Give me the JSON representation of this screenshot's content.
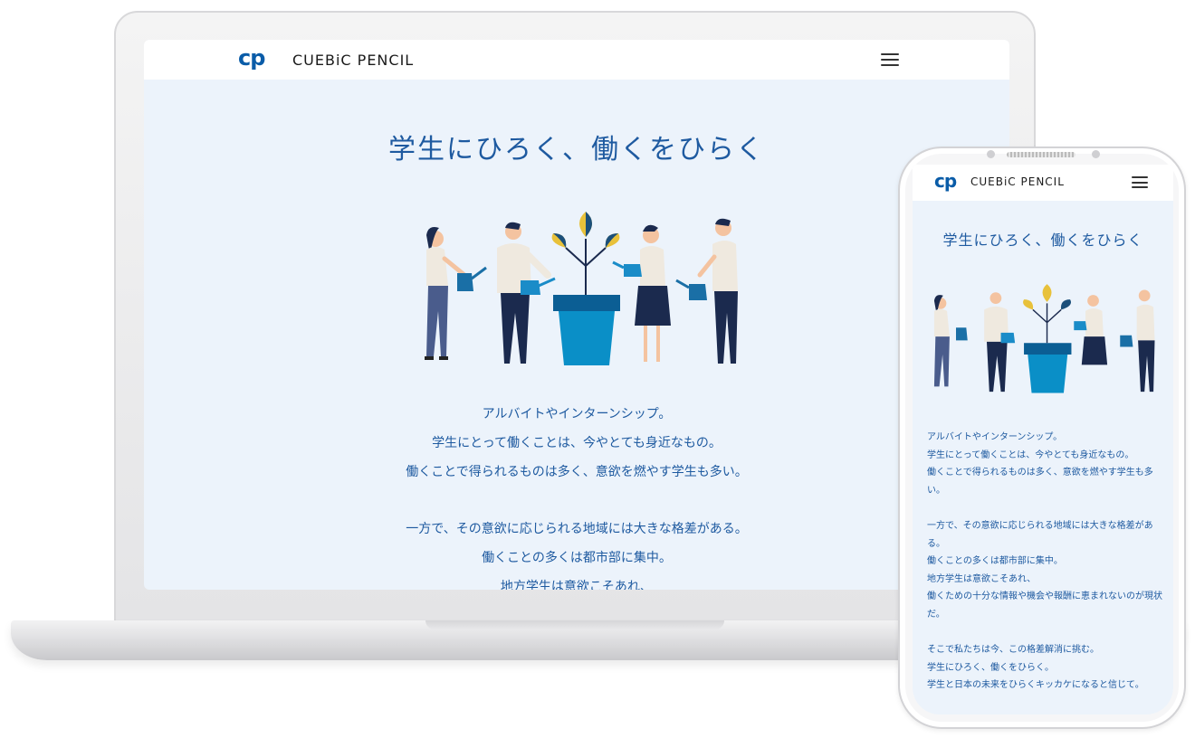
{
  "brand": {
    "mark": "cp",
    "name": "CUEBiC PENCIL"
  },
  "hero": {
    "title": "学生にひろく、働くをひらく"
  },
  "desktop_copy": [
    "アルバイトやインターンシップ。",
    "学生にとって働くことは、今やとても身近なもの。",
    "働くことで得られるものは多く、意欲を燃やす学生も多い。",
    "",
    "一方で、その意欲に応じられる地域には大きな格差がある。",
    "働くことの多くは都市部に集中。",
    "地方学生は意欲こそあれ、"
  ],
  "mobile_copy": [
    "アルバイトやインターンシップ。",
    "学生にとって働くことは、今やとても身近なもの。",
    "働くことで得られるものは多く、意欲を燃やす学生も多",
    "い。",
    "",
    "一方で、その意欲に応じられる地域には大きな格差があ",
    "る。",
    "働くことの多くは都市部に集中。",
    "地方学生は意欲こそあれ、",
    "働くための十分な情報や機会や報酬に恵まれないのが現状",
    "だ。",
    "",
    "そこで私たちは今、この格差解消に挑む。",
    "学生にひろく、働くをひらく。",
    "学生と日本の未来をひらくキッカケになると信じて。"
  ],
  "colors": {
    "brand_blue": "#1e5aa0",
    "logo_blue": "#0a5ca8",
    "screen_bg": "#ecf3fb",
    "pot": "#0a8fc7",
    "leaf_yellow": "#e8c13a",
    "navy": "#1b2a4e"
  },
  "icons": {
    "menu": "hamburger-icon",
    "logo": "cp-logo-icon"
  }
}
